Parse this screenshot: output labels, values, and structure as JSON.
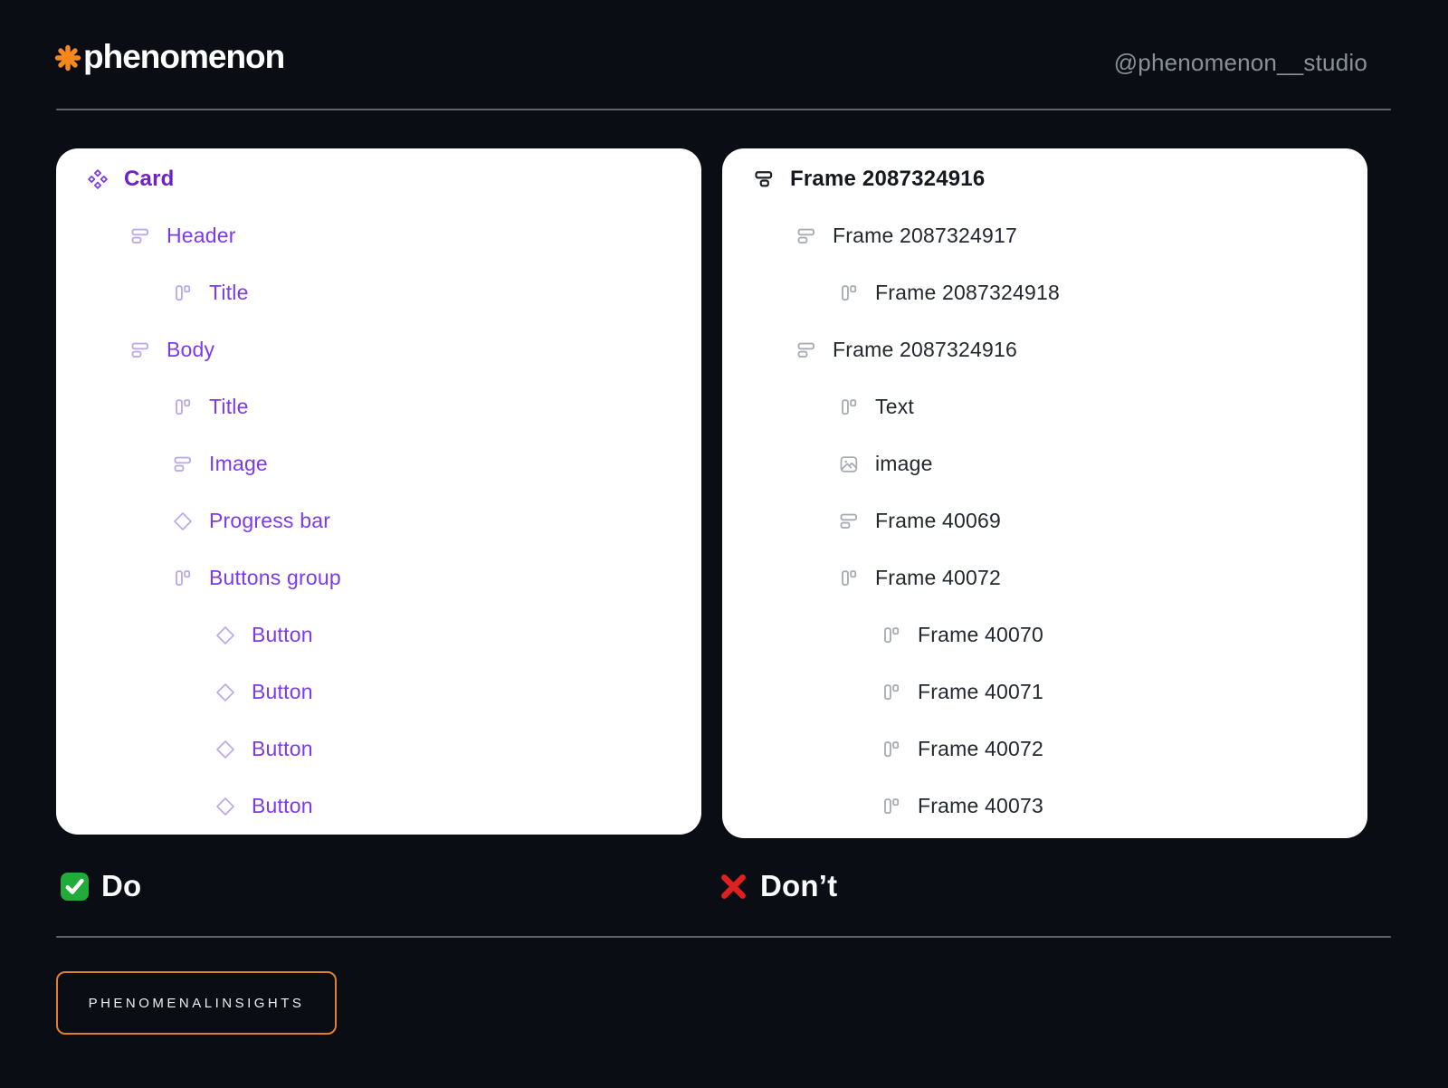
{
  "header": {
    "logo_text": "phenomenon",
    "handle": "@phenomenon__studio"
  },
  "do_panel": {
    "caption": "Do",
    "rows": [
      {
        "label": "Card",
        "icon": "component-icon",
        "level": 0,
        "bold": true
      },
      {
        "label": "Header",
        "icon": "frame-icon",
        "level": 1
      },
      {
        "label": "Title",
        "icon": "hlayout-icon",
        "level": 2
      },
      {
        "label": "Body",
        "icon": "frame-icon",
        "level": 1
      },
      {
        "label": "Title",
        "icon": "hlayout-icon",
        "level": 2
      },
      {
        "label": "Image",
        "icon": "frame-icon",
        "level": 2
      },
      {
        "label": "Progress bar",
        "icon": "diamond-icon",
        "level": 2
      },
      {
        "label": "Buttons group",
        "icon": "hlayout-icon",
        "level": 2
      },
      {
        "label": "Button",
        "icon": "diamond-icon",
        "level": 3
      },
      {
        "label": "Button",
        "icon": "diamond-icon",
        "level": 3
      },
      {
        "label": "Button",
        "icon": "diamond-icon",
        "level": 3
      },
      {
        "label": "Button",
        "icon": "diamond-icon",
        "level": 3
      }
    ]
  },
  "dont_panel": {
    "caption": "Don’t",
    "rows": [
      {
        "label": "Frame 2087324916",
        "icon": "frame-header-icon",
        "level": 0,
        "bold": true
      },
      {
        "label": "Frame 2087324917",
        "icon": "frame-icon",
        "level": 1
      },
      {
        "label": "Frame 2087324918",
        "icon": "hlayout-icon",
        "level": 2
      },
      {
        "label": "Frame 2087324916",
        "icon": "frame-icon",
        "level": 1
      },
      {
        "label": "Text",
        "icon": "hlayout-icon",
        "level": 2
      },
      {
        "label": "image",
        "icon": "image-icon",
        "level": 2
      },
      {
        "label": "Frame 40069",
        "icon": "frame-icon",
        "level": 2
      },
      {
        "label": "Frame 40072",
        "icon": "hlayout-icon",
        "level": 2
      },
      {
        "label": "Frame 40070",
        "icon": "hlayout-icon",
        "level": 3
      },
      {
        "label": "Frame 40071",
        "icon": "hlayout-icon",
        "level": 3
      },
      {
        "label": "Frame 40072",
        "icon": "hlayout-icon",
        "level": 3
      },
      {
        "label": "Frame 40073",
        "icon": "hlayout-icon",
        "level": 3
      }
    ]
  },
  "footer": {
    "tag_label": "PHENOMENALINSIGHTS"
  },
  "colors": {
    "background": "#0A0E14",
    "accent_orange": "#F5871F",
    "purple_text": "#7C3AED",
    "purple_bold": "#6D21C9",
    "purple_icon": "#BCA9E9",
    "dark_text": "#23272E",
    "gray_icon": "#A8ACB3",
    "check_green": "#21AB38",
    "cross_red": "#E02020",
    "card_bg": "#FFFFFF"
  }
}
